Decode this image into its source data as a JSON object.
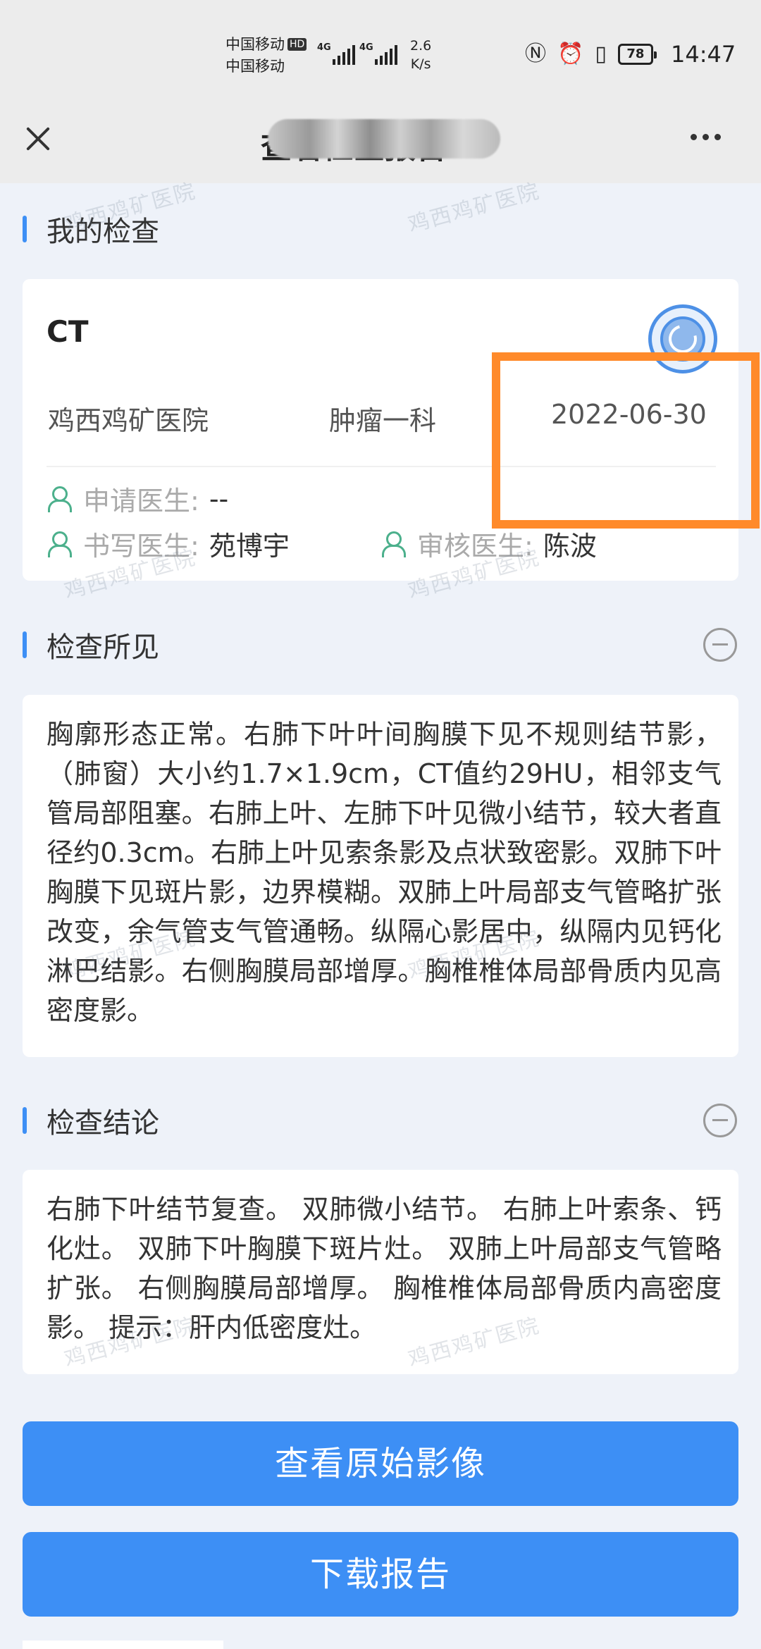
{
  "status_bar": {
    "carrier_1": "中国移动",
    "hd_badge": "HD",
    "carrier_2": "中国移动",
    "signal_1_label": "4G",
    "signal_2_label": "4G",
    "net_speed_value": "2.6",
    "net_speed_unit": "K/s",
    "battery_level": "78",
    "time": "14:47",
    "icons": [
      "nfc-icon",
      "alarm-icon",
      "vibrate-icon"
    ]
  },
  "nav": {
    "title": "查看检查报告",
    "title_obscured": true
  },
  "watermark_text": "鸡西鸡矿医院",
  "my_exam": {
    "section_title": "我的检查",
    "type": "CT",
    "hospital": "鸡西鸡矿医院",
    "department": "肿瘤一科",
    "date": "2022-06-30",
    "requesting_doctor_label": "申请医生:",
    "requesting_doctor": "--",
    "writing_doctor_label": "书写医生:",
    "writing_doctor": "苑博宇",
    "reviewing_doctor_label": "审核医生:",
    "reviewing_doctor": "陈波"
  },
  "findings": {
    "section_title": "检查所见",
    "text": "胸廓形态正常。右肺下叶叶间胸膜下见不规则结节影，（肺窗）大小约1.7×1.9cm，CT值约29HU，相邻支气管局部阻塞。右肺上叶、左肺下叶见微小结节，较大者直径约0.3cm。右肺上叶见索条影及点状致密影。双肺下叶胸膜下见斑片影，边界模糊。双肺上叶局部支气管略扩张改变，余气管支气管通畅。纵隔心影居中，纵隔内见钙化淋巴结影。右侧胸膜局部增厚。胸椎椎体局部骨质内见高密度影。"
  },
  "conclusion": {
    "section_title": "检查结论",
    "text": "右肺下叶结节复查。 双肺微小结节。 右肺上叶索条、钙化灶。 双肺下叶胸膜下斑片灶。 双肺上叶局部支气管略扩张。 右侧胸膜局部增厚。 胸椎椎体局部骨质内高密度影。 提示：肝内低密度灶。"
  },
  "actions": {
    "view_images": "查看原始影像",
    "download_report": "下载报告"
  },
  "colors": {
    "accent": "#3d8ff5",
    "highlight": "#ff8a2a",
    "doctor_icon": "#4cb08c",
    "background": "#eef2f9"
  }
}
